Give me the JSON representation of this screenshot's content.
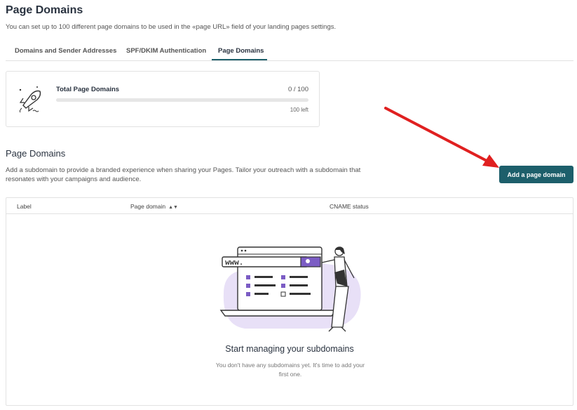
{
  "header": {
    "title": "Page Domains",
    "description": "You can set up to 100 different page domains to be used in the «page URL» field of your landing pages settings."
  },
  "tabs": [
    {
      "label": "Domains and Sender Addresses",
      "active": false
    },
    {
      "label": "SPF/DKIM Authentication",
      "active": false
    },
    {
      "label": "Page Domains",
      "active": true
    }
  ],
  "stats": {
    "label": "Total Page Domains",
    "count": "0 / 100",
    "remaining": "100 left",
    "progress_fraction": 0
  },
  "section": {
    "title": "Page Domains",
    "description": "Add a subdomain to provide a branded experience when sharing your Pages. Tailor your outreach with a subdomain that resonates with your campaigns and audience.",
    "add_button_label": "Add a page domain"
  },
  "table": {
    "columns": [
      "Label",
      "Page domain",
      "CNAME status"
    ],
    "sort_icon": "sort-updown-icon"
  },
  "empty_state": {
    "browser_text": "www.",
    "title": "Start managing your subdomains",
    "description": "You don't have any subdomains yet. It's time to add your first one."
  },
  "colors": {
    "accent": "#1d5f6b",
    "annotation_arrow": "#e02020",
    "illustration_purple": "#e8e0f7",
    "illustration_accent": "#7b5cc4"
  }
}
